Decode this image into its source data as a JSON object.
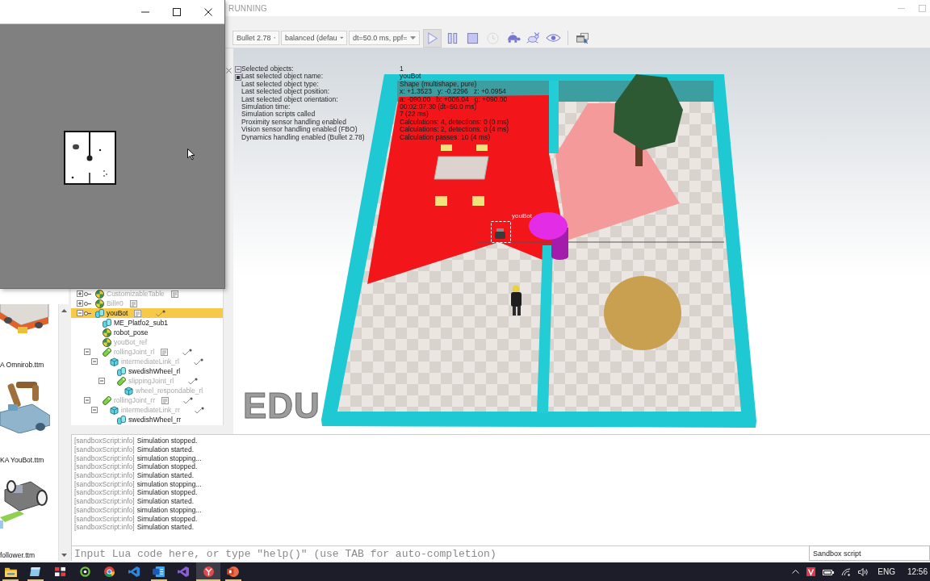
{
  "main_window": {
    "title": "RUNNING"
  },
  "toolbar": {
    "dropdowns": [
      {
        "value": "Bullet 2.78"
      },
      {
        "value": "balanced (defau"
      },
      {
        "value": "dt=50.0 ms, ppf="
      }
    ],
    "buttons": [
      {
        "kind": "play",
        "pressed": true,
        "disabled": false
      },
      {
        "kind": "pause",
        "pressed": false,
        "disabled": false
      },
      {
        "kind": "stop",
        "pressed": false,
        "disabled": false
      },
      {
        "kind": "clock",
        "pressed": false,
        "disabled": true
      },
      {
        "kind": "turtle",
        "pressed": false,
        "disabled": false
      },
      {
        "kind": "rabbit",
        "pressed": false,
        "disabled": false
      },
      {
        "kind": "eye",
        "pressed": false,
        "disabled": false
      },
      {
        "kind": "windows",
        "pressed": false,
        "disabled": false
      }
    ]
  },
  "model_browser": {
    "items": [
      {
        "kind": "mobile-base",
        "label": "A Omnirob.ttm"
      },
      {
        "kind": "arm-on-base",
        "label": "KA YouBot.ttm"
      },
      {
        "kind": "line-follower",
        "label": "follower.ttm"
      }
    ]
  },
  "scene_hierarchy": {
    "items": [
      {
        "name": "CustomizableTable",
        "kind": "dummy",
        "dimmed": true,
        "selected": false,
        "expanded": false,
        "has_script": true,
        "dynamic": false
      },
      {
        "name": "Bill#0",
        "kind": "dummy",
        "dimmed": true,
        "selected": false,
        "expanded": false,
        "has_script": true,
        "dynamic": false
      },
      {
        "name": "youBot",
        "kind": "multishape",
        "dimmed": false,
        "selected": true,
        "expanded": true,
        "has_script": true,
        "dynamic": true,
        "children": [
          {
            "name": "ME_Platfo2_sub1",
            "kind": "multishape",
            "dimmed": false,
            "selected": false,
            "has_script": false,
            "dynamic": false
          },
          {
            "name": "robot_pose",
            "kind": "dummy",
            "dimmed": false,
            "selected": false,
            "has_script": false,
            "dynamic": false
          },
          {
            "name": "youBot_ref",
            "kind": "dummy",
            "dimmed": true,
            "selected": false,
            "has_script": false,
            "dynamic": false
          },
          {
            "name": "rollingJoint_rl",
            "kind": "joint",
            "dimmed": true,
            "selected": false,
            "expanded": true,
            "has_script": true,
            "dynamic": true,
            "children": [
              {
                "name": "intermediateLink_rl",
                "kind": "shape",
                "dimmed": true,
                "selected": false,
                "expanded": true,
                "has_script": false,
                "dynamic": true,
                "children": [
                  {
                    "name": "swedishWheel_rl",
                    "kind": "multishape",
                    "dimmed": false,
                    "selected": false,
                    "has_script": false,
                    "dynamic": false
                  },
                  {
                    "name": "slippingJoint_rl",
                    "kind": "joint",
                    "dimmed": true,
                    "selected": false,
                    "expanded": true,
                    "has_script": false,
                    "dynamic": true,
                    "children": [
                      {
                        "name": "wheel_respondable_rl",
                        "kind": "shape",
                        "dimmed": true,
                        "selected": false,
                        "has_script": false,
                        "dynamic": false
                      }
                    ]
                  }
                ]
              }
            ]
          },
          {
            "name": "rollingJoint_rr",
            "kind": "joint",
            "dimmed": true,
            "selected": false,
            "expanded": true,
            "has_script": true,
            "dynamic": true,
            "children": [
              {
                "name": "intermediateLink_rr",
                "kind": "shape",
                "dimmed": true,
                "selected": false,
                "expanded": true,
                "has_script": false,
                "dynamic": true,
                "children": [
                  {
                    "name": "swedishWheel_rr",
                    "kind": "multishape",
                    "dimmed": false,
                    "selected": false,
                    "has_script": false,
                    "dynamic": false
                  }
                ]
              }
            ]
          }
        ]
      }
    ]
  },
  "scene_view": {
    "info": [
      {
        "label": "Selected objects:",
        "value": "1"
      },
      {
        "label": "Last selected object name:",
        "value": "youBot"
      },
      {
        "label": "Last selected object type:",
        "value": "Shape (multishape, pure)"
      },
      {
        "label": "Last selected object position:",
        "value": "x: +1.3523   y: -0.2296   z: +0.0954"
      },
      {
        "label": "Last selected object orientation:",
        "value": "a: -090.00   b: +006.04   g: +090.00"
      },
      {
        "label": "Simulation time:",
        "value": "00:02:07.30 (dt=50.0 ms)"
      },
      {
        "label": "Simulation scripts called",
        "value": "7 (22 ms)"
      },
      {
        "label": "Proximity sensor handling enabled",
        "value": "Calculations: 4, detections: 0 (0 ms)"
      },
      {
        "label": "Vision sensor handling enabled (FBO)",
        "value": "Calculations: 2, detections: 0 (4 ms)"
      },
      {
        "label": "Dynamics handling enabled (Bullet 2.78)",
        "value": "Calculation passes: 10 (4 ms)"
      }
    ],
    "object_label": "youBot",
    "edition_mark": "EDU"
  },
  "console": {
    "lines": [
      {
        "source": "[sandboxScript:info]",
        "message": "Simulation stopped."
      },
      {
        "source": "[sandboxScript:info]",
        "message": "Simulation started."
      },
      {
        "source": "[sandboxScript:info]",
        "message": "simulation stopping..."
      },
      {
        "source": "[sandboxScript:info]",
        "message": "Simulation stopped."
      },
      {
        "source": "[sandboxScript:info]",
        "message": "Simulation started."
      },
      {
        "source": "[sandboxScript:info]",
        "message": "simulation stopping..."
      },
      {
        "source": "[sandboxScript:info]",
        "message": "Simulation stopped."
      },
      {
        "source": "[sandboxScript:info]",
        "message": "Simulation started."
      },
      {
        "source": "[sandboxScript:info]",
        "message": "simulation stopping..."
      },
      {
        "source": "[sandboxScript:info]",
        "message": "Simulation stopped."
      },
      {
        "source": "[sandboxScript:info]",
        "message": "Simulation started."
      }
    ]
  },
  "command_line": {
    "placeholder": "Input Lua code here, or type \"help()\" (use TAB for auto-completion)",
    "script": "Sandbox script"
  },
  "taskbar": {
    "apps": [
      {
        "kind": "folder",
        "running": true,
        "selected": false
      },
      {
        "kind": "sheet",
        "running": true,
        "selected": false
      },
      {
        "kind": "tiles",
        "running": false,
        "selected": false
      },
      {
        "kind": "ring",
        "running": false,
        "selected": false
      },
      {
        "kind": "browser",
        "running": false,
        "selected": false
      },
      {
        "kind": "code-editor",
        "running": false,
        "selected": false
      },
      {
        "kind": "document",
        "running": true,
        "selected": false
      },
      {
        "kind": "ribbon",
        "running": false,
        "selected": false
      },
      {
        "kind": "robot-app",
        "running": true,
        "selected": true
      },
      {
        "kind": "slides",
        "running": true,
        "selected": false
      }
    ],
    "language": "ENG",
    "time": "12:56"
  }
}
